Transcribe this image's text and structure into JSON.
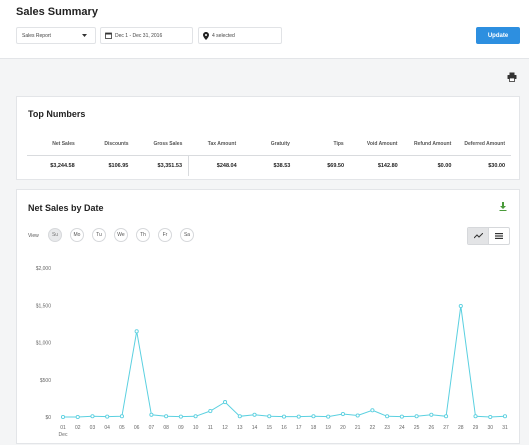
{
  "header": {
    "title": "Sales Summary",
    "report_select": "Sales Report",
    "date_range": "Dec 1 - Dec 31, 2016",
    "locations": "4 selected",
    "update_label": "Update"
  },
  "top_numbers": {
    "title": "Top Numbers",
    "columns": [
      {
        "label": "Net Sales",
        "value": "$3,244.58"
      },
      {
        "label": "Discounts",
        "value": "$106.95"
      },
      {
        "label": "Gross Sales",
        "value": "$3,351.53"
      },
      {
        "label": "Tax Amount",
        "value": "$248.04"
      },
      {
        "label": "Gratuity",
        "value": "$38.53"
      },
      {
        "label": "Tips",
        "value": "$69.50"
      },
      {
        "label": "Void Amount",
        "value": "$142.80"
      },
      {
        "label": "Refund Amount",
        "value": "$0.00"
      },
      {
        "label": "Deferred Amount",
        "value": "$30.00"
      }
    ]
  },
  "net_sales_chart": {
    "title": "Net Sales by Date",
    "view_label": "View",
    "days": [
      "Su",
      "Mo",
      "Tu",
      "We",
      "Th",
      "Fr",
      "Sa"
    ],
    "active_day": "Su",
    "line_color": "#5bd0e0"
  },
  "chart_data": {
    "type": "line",
    "x": [
      "01",
      "02",
      "03",
      "04",
      "05",
      "06",
      "07",
      "08",
      "09",
      "10",
      "11",
      "12",
      "13",
      "14",
      "15",
      "16",
      "17",
      "18",
      "19",
      "20",
      "21",
      "22",
      "23",
      "24",
      "25",
      "26",
      "27",
      "28",
      "29",
      "30",
      "31"
    ],
    "x_sublabel": "Dec",
    "y_ticks": [
      "$0",
      "$500",
      "$1,000",
      "$1,500",
      "$2,000"
    ],
    "ylim": [
      0,
      2000
    ],
    "series": [
      {
        "values": [
          0,
          0,
          10,
          5,
          10,
          1150,
          30,
          10,
          5,
          10,
          80,
          200,
          10,
          30,
          10,
          5,
          5,
          10,
          5,
          40,
          20,
          90,
          10,
          5,
          10,
          30,
          10,
          1490,
          10,
          0,
          10
        ]
      }
    ],
    "grid": false
  }
}
